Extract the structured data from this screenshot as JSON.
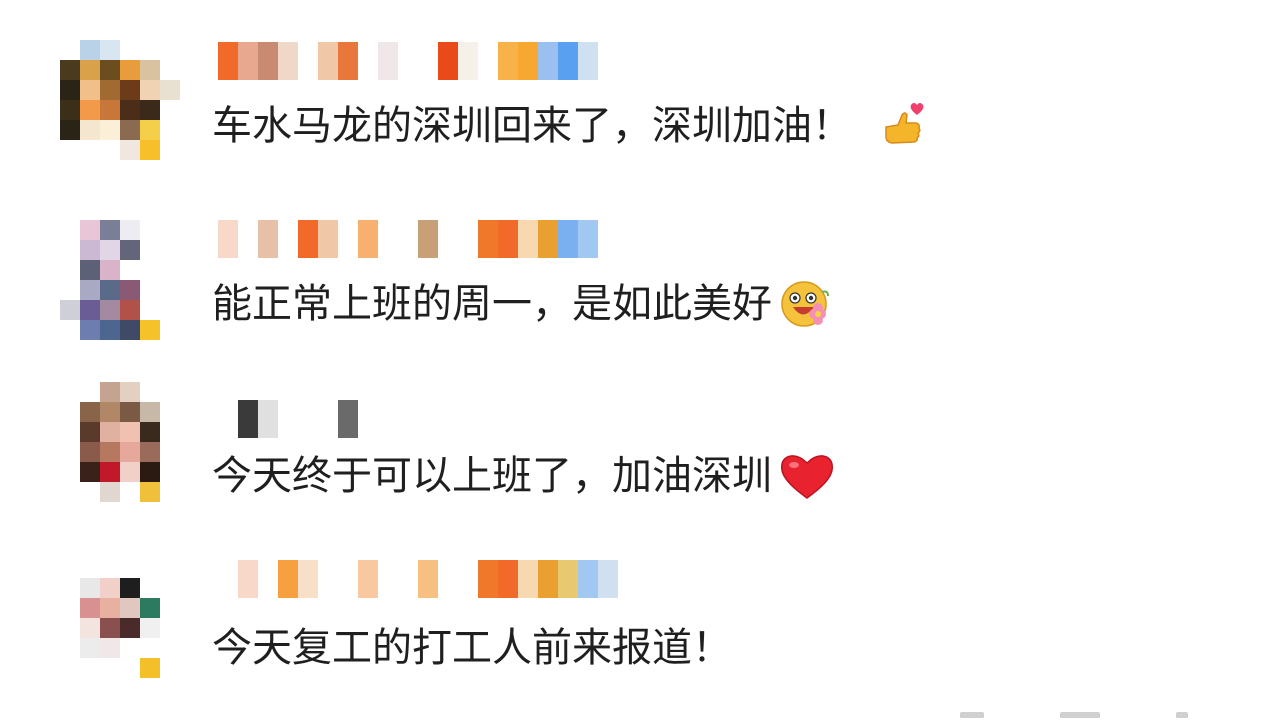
{
  "comments": [
    {
      "text": "车水马龙的深圳回来了，深圳加油！",
      "emoji": "thumbs-up-heart-icon"
    },
    {
      "text": "能正常上班的周一，是如此美好",
      "emoji": "happy-face-flower-icon"
    },
    {
      "text": "今天终于可以上班了，加油深圳",
      "emoji": "red-heart-icon"
    },
    {
      "text": "今天复工的打工人前来报道！",
      "emoji": ""
    }
  ],
  "colors": {
    "text": "#1f1f1f",
    "background": "#ffffff",
    "heart": "#e8222f",
    "emoji_yellow": "#f5b52a"
  }
}
